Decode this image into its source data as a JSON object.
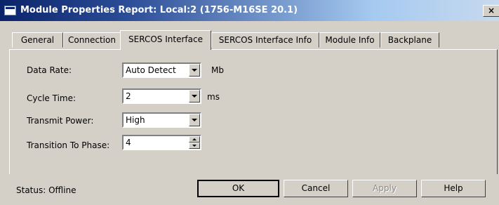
{
  "window": {
    "title": "Module Properties Report: Local:2 (1756-M16SE 20.1)",
    "close_glyph": "×"
  },
  "tabs": [
    {
      "label": "General"
    },
    {
      "label": "Connection"
    },
    {
      "label": "SERCOS Interface"
    },
    {
      "label": "SERCOS Interface Info"
    },
    {
      "label": "Module Info"
    },
    {
      "label": "Backplane"
    }
  ],
  "active_tab": "SERCOS Interface",
  "form": {
    "data_rate": {
      "label": "Data Rate:",
      "value": "Auto Detect",
      "unit": "Mb"
    },
    "cycle_time": {
      "label": "Cycle Time:",
      "value": "2",
      "unit": "ms"
    },
    "transmit_power": {
      "label": "Transmit Power:",
      "value": "High"
    },
    "transition_to_phase": {
      "label": "Transition To Phase:",
      "value": "4"
    }
  },
  "status": {
    "label": "Status:",
    "value": "Offline"
  },
  "buttons": {
    "ok": "OK",
    "cancel": "Cancel",
    "apply": "Apply",
    "help": "Help"
  },
  "icons": {
    "window_icon": "window-icon",
    "dropdown": "chevron-down-icon",
    "spinner": "spinner-icon"
  }
}
